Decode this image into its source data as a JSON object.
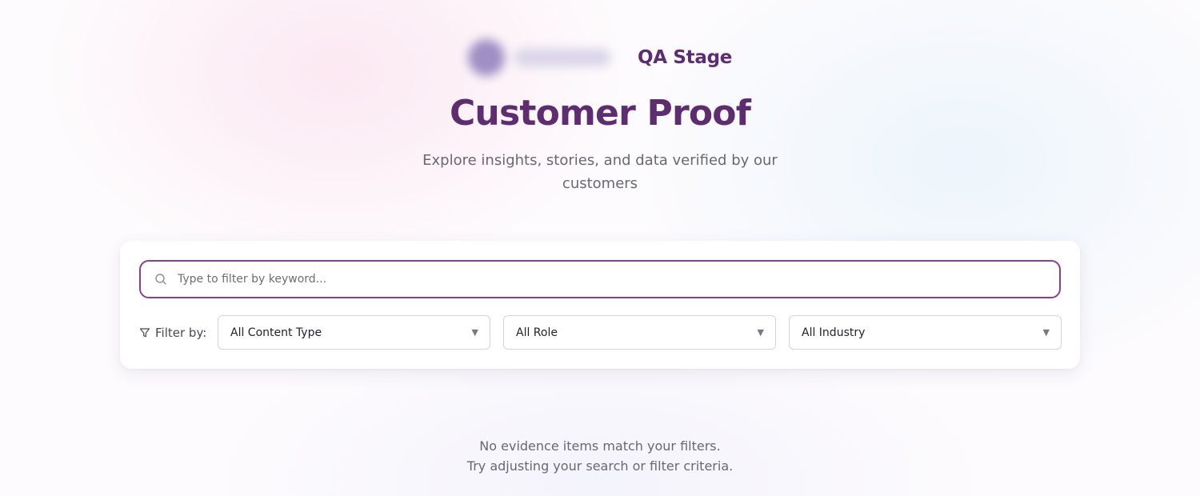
{
  "header": {
    "brand_name": "QA Stage",
    "title": "Customer Proof",
    "subtitle": "Explore insights, stories, and data verified by our customers"
  },
  "search": {
    "placeholder": "Type to filter by keyword...",
    "value": ""
  },
  "filters": {
    "label": "Filter by:",
    "selects": [
      {
        "name": "content-type",
        "value": "All Content Type"
      },
      {
        "name": "role",
        "value": "All Role"
      },
      {
        "name": "industry",
        "value": "All Industry"
      }
    ]
  },
  "empty_state": {
    "line1": "No evidence items match your filters.",
    "line2": "Try adjusting your search or filter criteria."
  },
  "colors": {
    "brand": "#5d2d6f",
    "search_border": "#8a3f8c",
    "muted_text": "#6a6773"
  },
  "icons": {
    "search": "search-icon",
    "filter": "filter-icon",
    "caret": "chevron-down-icon"
  }
}
